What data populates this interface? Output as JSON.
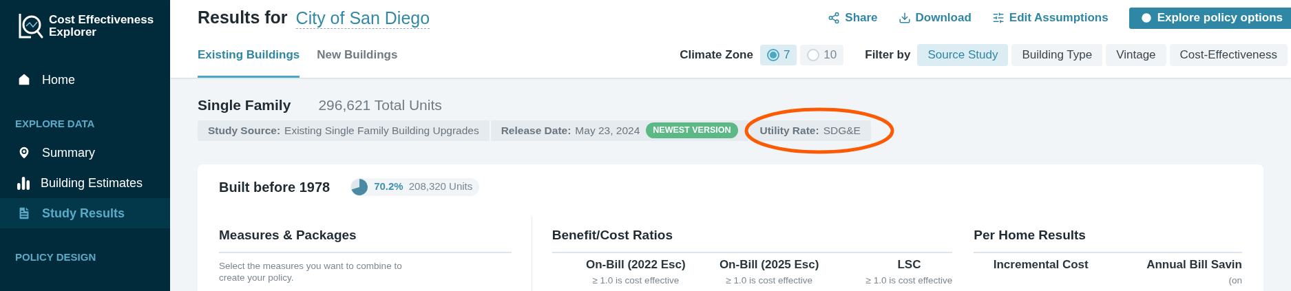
{
  "app": {
    "name": "Cost Effectiveness Explorer"
  },
  "sidebar": {
    "items": [
      {
        "kind": "link",
        "label": "Home",
        "selected": false
      },
      {
        "kind": "section",
        "label": "EXPLORE DATA"
      },
      {
        "kind": "link",
        "label": "Summary",
        "selected": false
      },
      {
        "kind": "link",
        "label": "Building Estimates",
        "selected": false
      },
      {
        "kind": "link",
        "label": "Study Results",
        "selected": true
      },
      {
        "kind": "section",
        "label": "POLICY DESIGN"
      }
    ]
  },
  "header": {
    "title": "Results for",
    "jurisdiction": "City of San Diego",
    "actions": [
      {
        "label": "Share"
      },
      {
        "label": "Download"
      },
      {
        "label": "Edit Assumptions"
      }
    ],
    "primary_button": "Explore policy options",
    "tabs": [
      {
        "label": "Existing Buildings",
        "selected": true
      },
      {
        "label": "New Buildings",
        "selected": false
      }
    ],
    "climate_zone": {
      "label": "Climate Zone",
      "options": [
        {
          "label": "7",
          "selected": true
        },
        {
          "label": "10",
          "selected": false
        }
      ]
    },
    "filter": {
      "label": "Filter by",
      "options": [
        {
          "label": "Source Study",
          "selected": true
        },
        {
          "label": "Building Type",
          "selected": false
        },
        {
          "label": "Vintage",
          "selected": false
        },
        {
          "label": "Cost-Effectiveness",
          "selected": false
        }
      ]
    }
  },
  "building": {
    "type": "Single Family",
    "total_units": "296,621 Total Units",
    "info": [
      {
        "label": "Study Source:",
        "value": "Existing Single Family Building Upgrades"
      },
      {
        "label": "Release Date:",
        "value": "May 23, 2024",
        "badge": "NEWEST VERSION"
      },
      {
        "label": "Utility Rate:",
        "value": "SDG&E",
        "circled": true
      }
    ]
  },
  "card": {
    "title": "Built before 1978",
    "share": {
      "percent": "70.2%",
      "units": "208,320 Units"
    },
    "measures": {
      "title": "Measures & Packages",
      "hint": "Select the measures you want to combine to create your policy."
    },
    "ratios": {
      "title": "Benefit/Cost Ratios",
      "columns": [
        {
          "name": "On-Bill (2022 Esc)",
          "note": "≥ 1.0 is cost effective"
        },
        {
          "name": "On-Bill (2025 Esc)",
          "note": "≥ 1.0 is cost effective"
        },
        {
          "name": "LSC",
          "note": "≥ 1.0 is cost effective"
        }
      ]
    },
    "per_home": {
      "title": "Per Home Results",
      "columns": [
        {
          "name": "Incremental Cost"
        },
        {
          "name": "Annual Bill Savin",
          "note": "(on"
        }
      ]
    }
  }
}
